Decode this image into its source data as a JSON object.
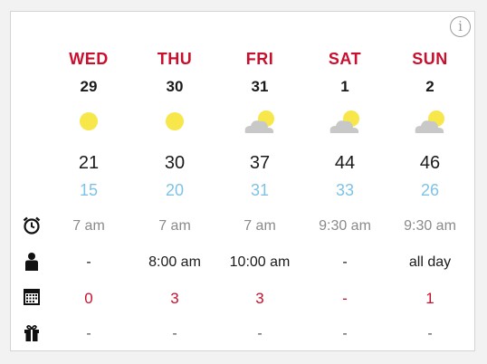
{
  "info_icon": "info-icon",
  "colors": {
    "day_name": "#c8102e",
    "low_temp": "#7ec3e6",
    "sun": "#f7e74a",
    "cloud": "#c8c8c8",
    "counts": "#c8102e"
  },
  "row_icons": [
    "alarm-clock-icon",
    "person-icon",
    "calendar-icon",
    "gift-icon"
  ],
  "days": [
    {
      "dow": "WED",
      "date": "29",
      "weather": "sunny",
      "hi": "21",
      "lo": "15",
      "alarm": "7 am",
      "person": "-",
      "calendar": "0",
      "gift": "-"
    },
    {
      "dow": "THU",
      "date": "30",
      "weather": "sunny",
      "hi": "30",
      "lo": "20",
      "alarm": "7 am",
      "person": "8:00 am",
      "calendar": "3",
      "gift": "-"
    },
    {
      "dow": "FRI",
      "date": "31",
      "weather": "partly-cloudy",
      "hi": "37",
      "lo": "31",
      "alarm": "7 am",
      "person": "10:00 am",
      "calendar": "3",
      "gift": "-"
    },
    {
      "dow": "SAT",
      "date": "1",
      "weather": "partly-cloudy",
      "hi": "44",
      "lo": "33",
      "alarm": "9:30 am",
      "person": "-",
      "calendar": "-",
      "gift": "-"
    },
    {
      "dow": "SUN",
      "date": "2",
      "weather": "partly-cloudy",
      "hi": "46",
      "lo": "26",
      "alarm": "9:30 am",
      "person": "all day",
      "calendar": "1",
      "gift": "-"
    }
  ]
}
